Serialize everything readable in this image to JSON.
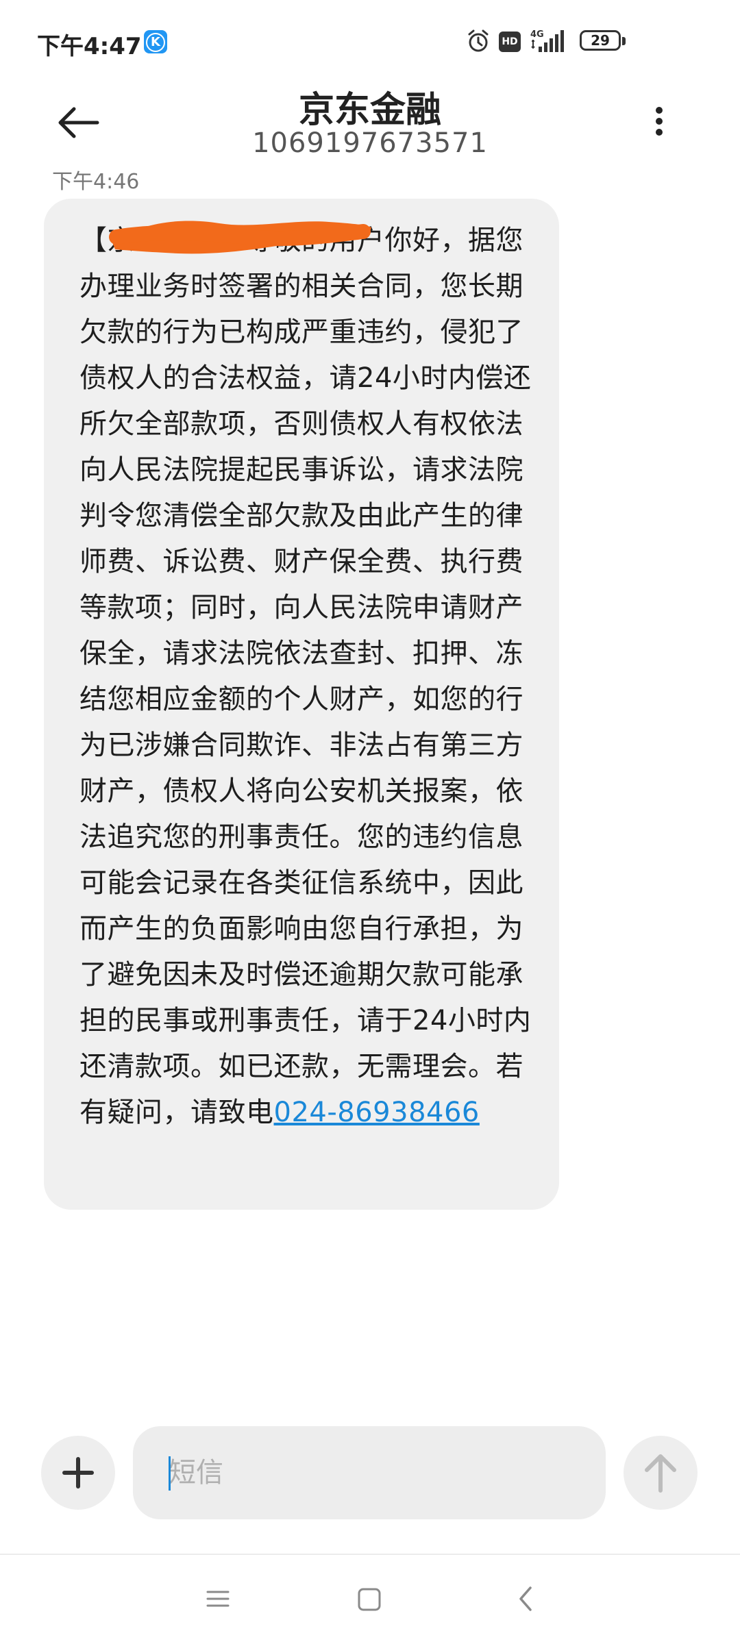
{
  "status_bar": {
    "time": "下午4:47",
    "app_badge": "K",
    "hd": "HD",
    "network": "4G",
    "battery": "29"
  },
  "header": {
    "contact_name": "京东金融",
    "contact_number": "1069197673571"
  },
  "conversation": {
    "timestamp": "下午4:46",
    "message_text": "【京东金融】尊敬的用户你好，据您办理业务时签署的相关合同，您长期欠款的行为已构成严重违约，侵犯了债权人的合法权益，请24小时内偿还所欠全部款项，否则债权人有权依法向人民法院提起民事诉讼，请求法院判令您清偿全部欠款及由此产生的律师费、诉讼费、财产保全费、执行费等款项；同时，向人民法院申请财产保全，请求法院依法查封、扣押、冻结您相应金额的个人财产，如您的行为已涉嫌合同欺诈、非法占有第三方财产，债权人将向公安机关报案，依法追究您的刑事责任。您的违约信息可能会记录在各类征信系统中，因此而产生的负面影响由您自行承担，为了避免因未及时偿还逾期欠款可能承担的民事或刑事责任，请于24小时内还清款项。如已还款，无需理会。若有疑问，请致电",
    "phone_link": "024-86938466"
  },
  "composer": {
    "placeholder": "短信"
  },
  "colors": {
    "link": "#1a88d8",
    "bubble": "#f0f0f0",
    "redaction": "#f26a1b"
  }
}
